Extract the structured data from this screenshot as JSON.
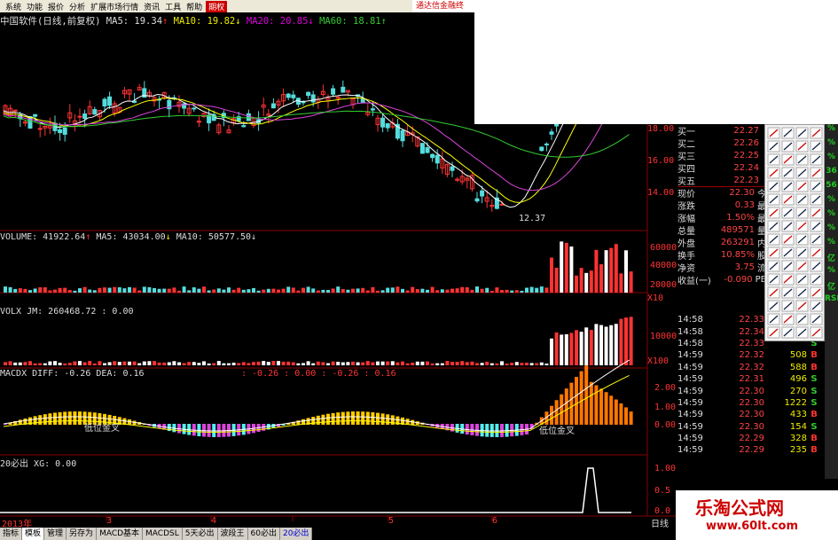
{
  "menubar": {
    "items": [
      "系统",
      "功能",
      "报价",
      "分析",
      "扩展市场行情",
      "资讯",
      "工具",
      "帮助"
    ],
    "highlight": "期权",
    "ad": "通达信金融终"
  },
  "ma_header": {
    "name": "中国软件(日线,前复权)",
    "ma5": "MA5: 19.34",
    "ma10": "MA10: 19.82",
    "ma20": "MA20: 20.85",
    "ma60": "MA60: 18.81"
  },
  "volume_header": {
    "vol": "VOLUME: 41922.64",
    "ma5": "MA5: 43034.00",
    "ma10": "MA10: 50577.50"
  },
  "volx_header": "VOLX JM: 260468.72  : 0.00",
  "macd_header": {
    "left": "MACDX DIFF: -0.26  DEA: 0.16",
    "right": ": -0.26  : 0.00  : -0.26  : 0.16"
  },
  "xg_header": "20必出 XG: 0.00",
  "price_axis": [
    "18.00",
    "16.00",
    "14.00"
  ],
  "vol_axis": [
    "60000",
    "40000",
    "20000",
    "X10"
  ],
  "volx_axis": [
    "10000",
    "X100"
  ],
  "macd_axis": [
    "2.00",
    "1.00",
    "0.00"
  ],
  "xg_axis": [
    "1.00",
    "0.5",
    "0.0"
  ],
  "low_label": "12.37",
  "gold_cross": [
    "低位金叉",
    "低位金叉"
  ],
  "date_axis": {
    "year": "2013年",
    "months": [
      "3",
      "4",
      "5",
      "6"
    ],
    "unit": "日线"
  },
  "quote": [
    {
      "k": "买一",
      "v": "22.27"
    },
    {
      "k": "买二",
      "v": "22.26"
    },
    {
      "k": "买三",
      "v": "22.25"
    },
    {
      "k": "买四",
      "v": "22.24"
    },
    {
      "k": "买五",
      "v": "22.23"
    },
    {
      "k": "现价",
      "v": "22.30",
      "x": "今"
    },
    {
      "k": "涨跌",
      "v": "0.33",
      "x": "最"
    },
    {
      "k": "涨幅",
      "v": "1.50%",
      "x": "最"
    },
    {
      "k": "总量",
      "v": "489571",
      "x": "量"
    },
    {
      "k": "外盘",
      "v": "263291",
      "x": "内"
    },
    {
      "k": "换手",
      "v": "10.85%",
      "x": "股"
    },
    {
      "k": "净资",
      "v": "3.75",
      "x": "流"
    },
    {
      "k": "收益(一)",
      "v": "-0.090",
      "x": "PE"
    }
  ],
  "trades": [
    {
      "t": "14:58",
      "p": "22.33",
      "q": "",
      "s": "B"
    },
    {
      "t": "14:58",
      "p": "22.34",
      "q": "",
      "s": "B"
    },
    {
      "t": "14:58",
      "p": "22.33",
      "q": "",
      "s": "S"
    },
    {
      "t": "14:59",
      "p": "22.32",
      "q": "508",
      "s": "B"
    },
    {
      "t": "14:59",
      "p": "22.32",
      "q": "588",
      "s": "B"
    },
    {
      "t": "14:59",
      "p": "22.31",
      "q": "496",
      "s": "S"
    },
    {
      "t": "14:59",
      "p": "22.30",
      "q": "270",
      "s": "S"
    },
    {
      "t": "14:59",
      "p": "22.30",
      "q": "1222",
      "s": "S"
    },
    {
      "t": "14:59",
      "p": "22.30",
      "q": "433",
      "s": "B"
    },
    {
      "t": "14:59",
      "p": "22.30",
      "q": "154",
      "s": "S"
    },
    {
      "t": "14:59",
      "p": "22.29",
      "q": "328",
      "s": "B"
    },
    {
      "t": "14:59",
      "p": "22.29",
      "q": "235",
      "s": "B"
    }
  ],
  "sidebar": [
    "%",
    "%",
    "%",
    "36",
    "56",
    "%",
    "%",
    "%",
    "%",
    "亿",
    "%",
    "亿",
    "RSI"
  ],
  "tabs": [
    "指标",
    "模板",
    "管理",
    "另存为",
    "MACD基本",
    "MACDSL",
    "5天必出",
    "波段王",
    "60必出",
    "20必出"
  ],
  "selected_tab": "模板",
  "watermark": {
    "title": "乐淘公式网",
    "url": "www.60lt.com"
  },
  "colors": {
    "up": "#ff3333",
    "down": "#55dddd",
    "ma5": "#ffffff",
    "ma10": "#ffff00",
    "ma20": "#dd44dd",
    "ma60": "#33cc33",
    "grid": "#990000"
  },
  "chart_data": {
    "type": "candlestick",
    "price_low": 12.37,
    "ma": {
      "MA5": 19.34,
      "MA10": 19.82,
      "MA20": 20.85,
      "MA60": 18.81
    },
    "volume": {
      "VOLUME": 41922.64,
      "MA5": 43034.0,
      "MA10": 50577.5
    },
    "volx_jm": 260468.72,
    "macd": {
      "DIFF": -0.26,
      "DEA": 0.16
    }
  }
}
